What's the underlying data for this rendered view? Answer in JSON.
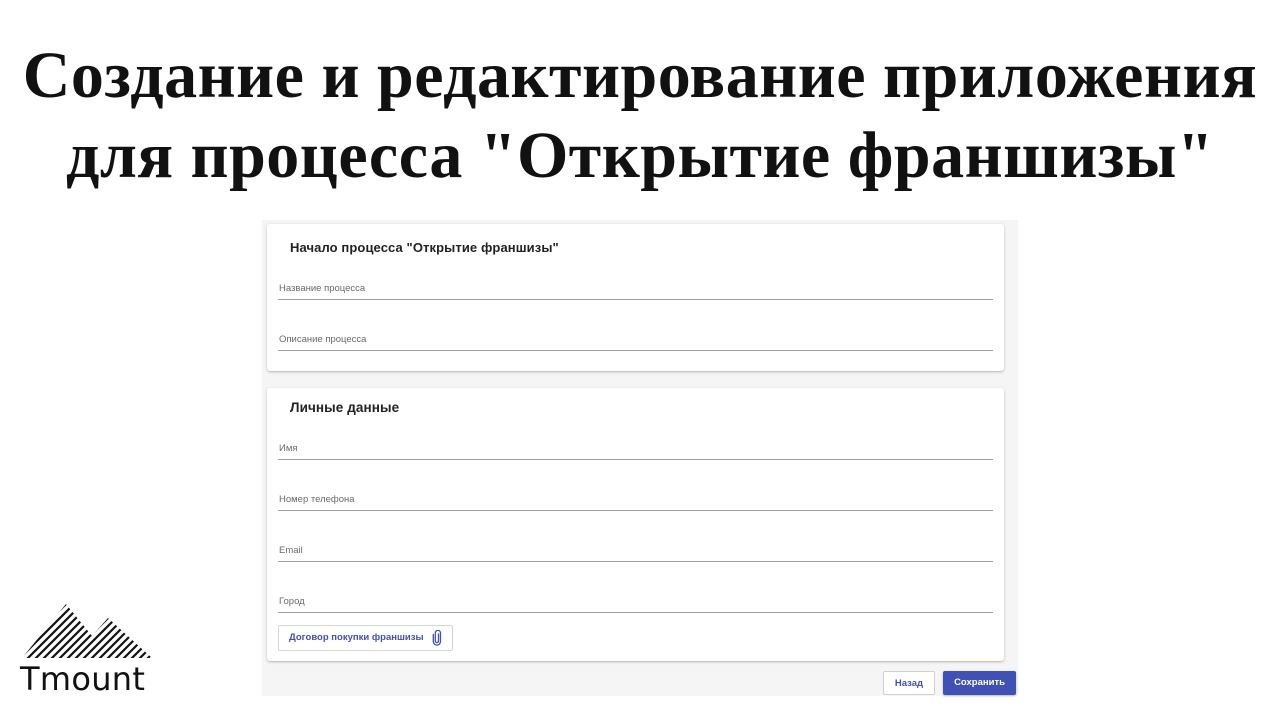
{
  "slide": {
    "title_line1": "Создание и редактирование приложения",
    "title_line2": "для процесса \"Открытие франшизы\""
  },
  "form": {
    "process_card": {
      "title": "Начало процесса \"Открытие франшизы\"",
      "fields": [
        {
          "label": "Название процесса",
          "value": ""
        },
        {
          "label": "Описание процесса",
          "value": ""
        }
      ]
    },
    "personal_card": {
      "title": "Личные данные",
      "fields": [
        {
          "label": "Имя",
          "value": ""
        },
        {
          "label": "Номер телефона",
          "value": ""
        },
        {
          "label": "Email",
          "value": ""
        },
        {
          "label": "Город",
          "value": ""
        }
      ],
      "attachment_label": "Договор покупки франшизы",
      "attachment_icon": "paperclip-icon"
    },
    "actions": {
      "back_label": "Назад",
      "save_label": "Сохранить"
    }
  },
  "logo": {
    "text": "Tmount",
    "icon": "mountains-logo-icon"
  },
  "colors": {
    "accent": "#3f51b5",
    "background_app": "#f5f5f5",
    "card": "#ffffff"
  }
}
